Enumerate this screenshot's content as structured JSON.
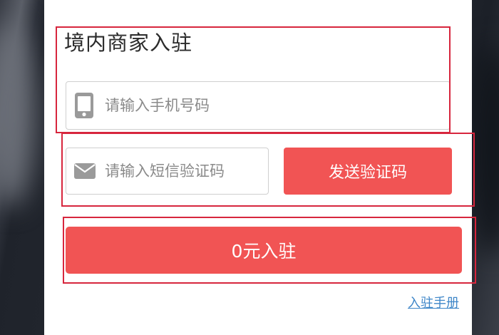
{
  "form": {
    "title": "境内商家入驻",
    "phone_placeholder": "请输入手机号码",
    "phone_value": "",
    "code_placeholder": "请输入短信验证码",
    "code_value": "",
    "send_code_label": "发送验证码",
    "submit_label": "0元入驻",
    "manual_link": "入驻手册"
  },
  "icons": {
    "phone": "mobile-phone-icon",
    "code": "envelope-icon"
  },
  "colors": {
    "accent": "#f15454",
    "link": "#3e86c8",
    "annotation": "#d7263d"
  }
}
